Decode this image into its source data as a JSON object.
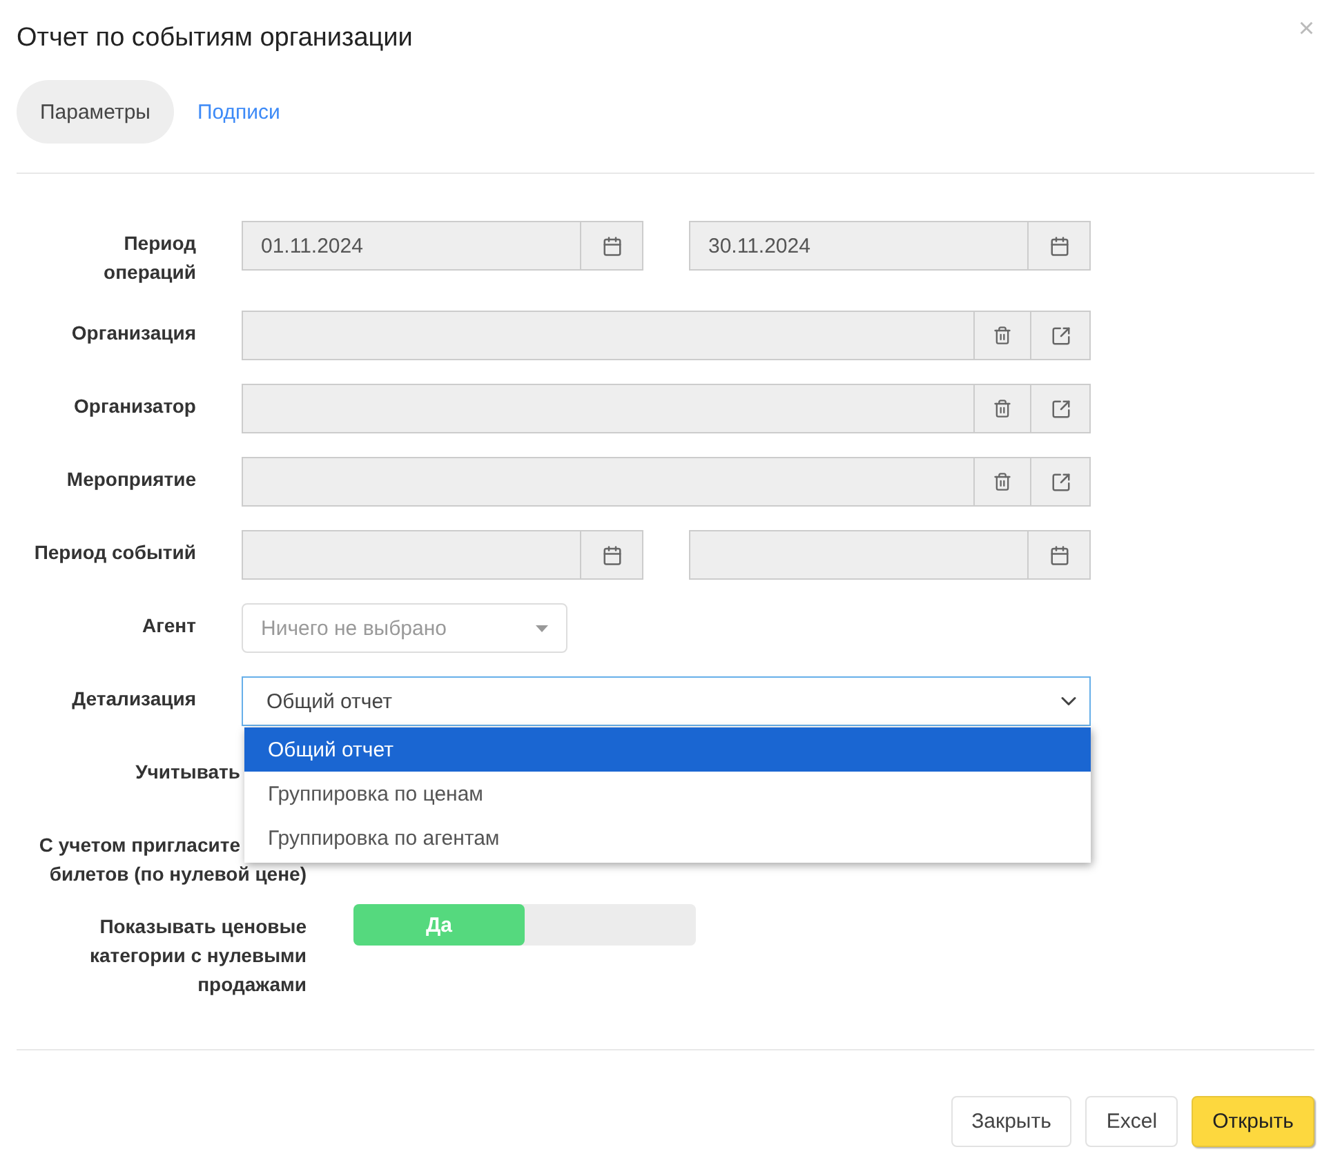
{
  "dialog": {
    "title": "Отчет по событиям организации",
    "close": "×"
  },
  "tabs": [
    {
      "label": "Параметры",
      "selected": true
    },
    {
      "label": "Подписи",
      "selected": false
    }
  ],
  "fields": [
    {
      "kind": "date_range",
      "label": [
        "Период",
        "операций"
      ],
      "from": "01.11.2024",
      "to": "30.11.2024"
    },
    {
      "kind": "lookup",
      "label": [
        "Организация"
      ]
    },
    {
      "kind": "lookup",
      "label": [
        "Организатор"
      ]
    },
    {
      "kind": "lookup",
      "label": [
        "Мероприятие"
      ]
    },
    {
      "kind": "date_range",
      "label": [
        "Период событий"
      ]
    },
    {
      "kind": "select",
      "label": [
        "Агент"
      ],
      "placeholder": "Ничего не выбрано"
    },
    {
      "kind": "dropdown",
      "label": [
        "Детализация"
      ],
      "value": "Общий отчет",
      "expanded": true,
      "options": [
        {
          "label": "Общий отчет",
          "selected": true
        },
        {
          "label": "Группировка по ценам",
          "selected": false
        },
        {
          "label": "Группировка по агентам",
          "selected": false
        }
      ]
    },
    {
      "kind": "covered",
      "label": [
        "Учитывать"
      ]
    },
    {
      "kind": "covered",
      "label": [
        "С учетом пригласите",
        "билетов (по нулевой цене)"
      ]
    },
    {
      "kind": "toggle",
      "label": [
        "Показывать ценовые",
        "категории с нулевыми",
        "продажами"
      ],
      "on": true,
      "on_label": "Да"
    }
  ],
  "buttons": [
    {
      "label": "Закрыть",
      "kind": "default"
    },
    {
      "label": "Excel",
      "kind": "default"
    },
    {
      "label": "Открыть",
      "kind": "primary"
    }
  ]
}
